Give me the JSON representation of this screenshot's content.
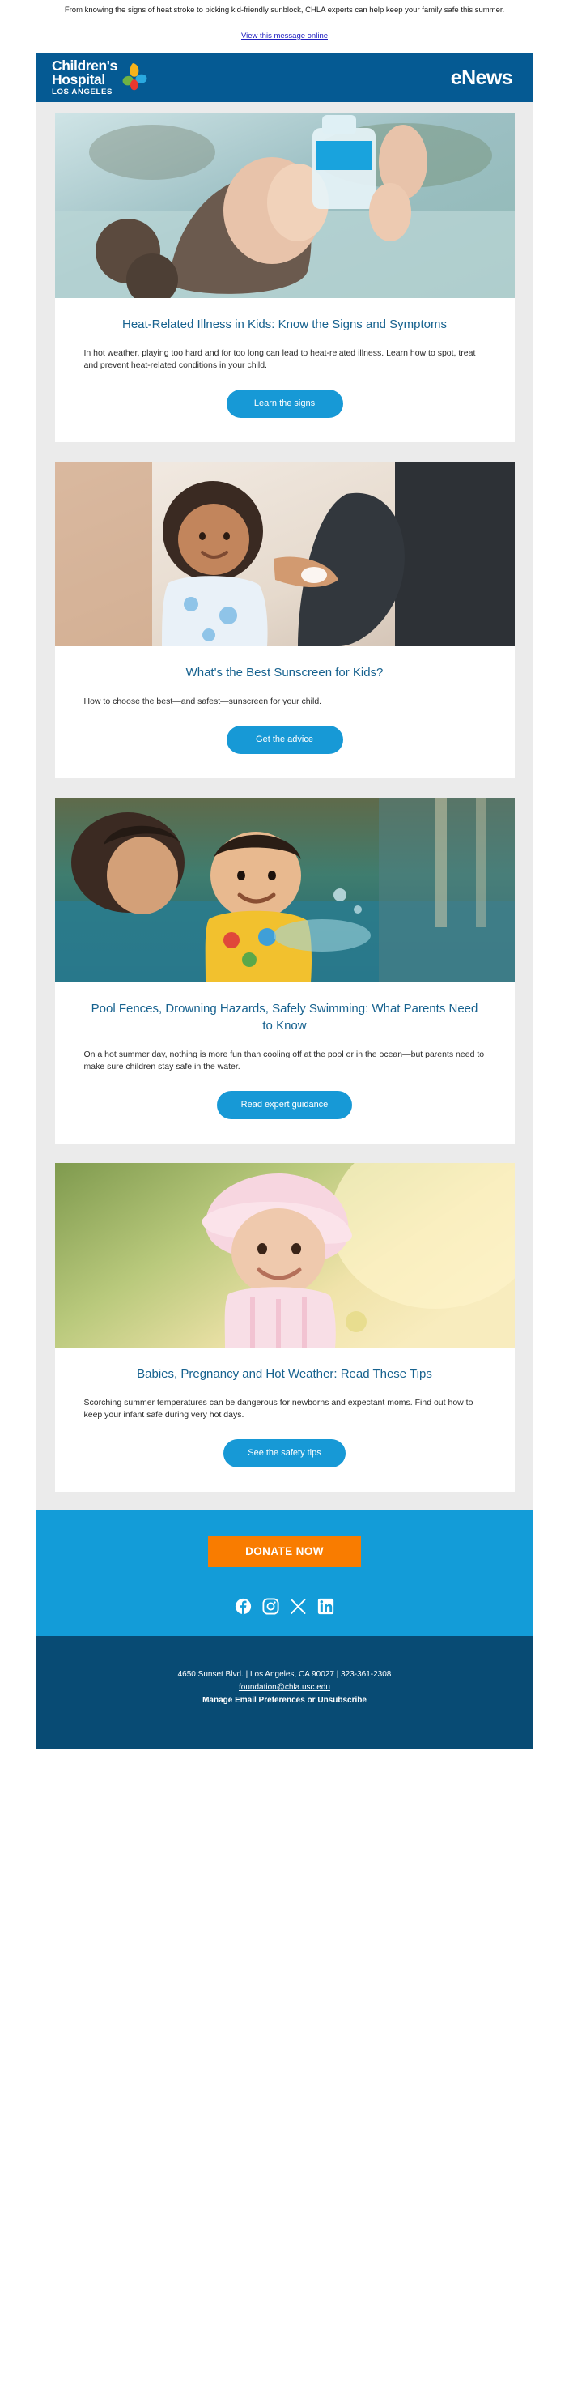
{
  "preheader": {
    "text": "From knowing the signs of heat stroke to picking kid-friendly sunblock, CHLA experts can help keep your family safe this summer.",
    "view_online": "View this message online"
  },
  "masthead": {
    "logo_line1": "Children's",
    "logo_line2": "Hospital",
    "logo_line3": "LOS ANGELES",
    "title": "eNews",
    "bg_color": "#055a93",
    "logo_petal_colors": {
      "yellow": "#f6b31c",
      "blue": "#2aa9e0",
      "green": "#6fb344",
      "red": "#e8382f"
    }
  },
  "articles": [
    {
      "image_alt": "Girl drinking water from a bottle outdoors",
      "title": "Heat-Related Illness in Kids: Know the Signs and Symptoms",
      "description": "In hot weather, playing too hard and for too long can lead to heat-related illness. Learn how to spot, treat and prevent heat-related conditions in your child.",
      "cta_label": "Learn the signs"
    },
    {
      "image_alt": "Adult applying sunscreen to a child's shoulder",
      "title": "What's the Best Sunscreen for Kids?",
      "description": "How to choose the best—and safest—sunscreen for your child.",
      "cta_label": "Get the advice"
    },
    {
      "image_alt": "Parent and toddler splashing in a pool",
      "title": "Pool Fences, Drowning Hazards, Safely Swimming: What Parents Need to Know",
      "description": "On a hot summer day, nothing is more fun than cooling off at the pool or in the ocean—but parents need to make sure children stay safe in the water.",
      "cta_label": "Read expert guidance"
    },
    {
      "image_alt": "Smiling baby wearing a pink sun hat",
      "title": "Babies, Pregnancy and Hot Weather: Read These Tips",
      "description": "Scorching summer temperatures can be dangerous for newborns and expectant moms. Find out how to keep your infant safe during very hot days.",
      "cta_label": "See the safety tips"
    }
  ],
  "donate": {
    "label": "DONATE NOW",
    "button_color": "#f97c00",
    "band_color": "#139cd8"
  },
  "social": [
    {
      "name": "facebook-icon",
      "label": "Facebook"
    },
    {
      "name": "instagram-icon",
      "label": "Instagram"
    },
    {
      "name": "x-twitter-icon",
      "label": "X"
    },
    {
      "name": "linkedin-icon",
      "label": "LinkedIn"
    }
  ],
  "footer": {
    "address": "4650 Sunset Blvd. | Los Angeles, CA 90027 | 323-361-2308",
    "email": "foundation@chla.usc.edu",
    "manage": "Manage Email Preferences or Unsubscribe",
    "bg_color": "#084b74"
  },
  "theme": {
    "title_color": "#17628f",
    "cta_color": "#1799d6",
    "page_bg": "#ebebeb"
  }
}
